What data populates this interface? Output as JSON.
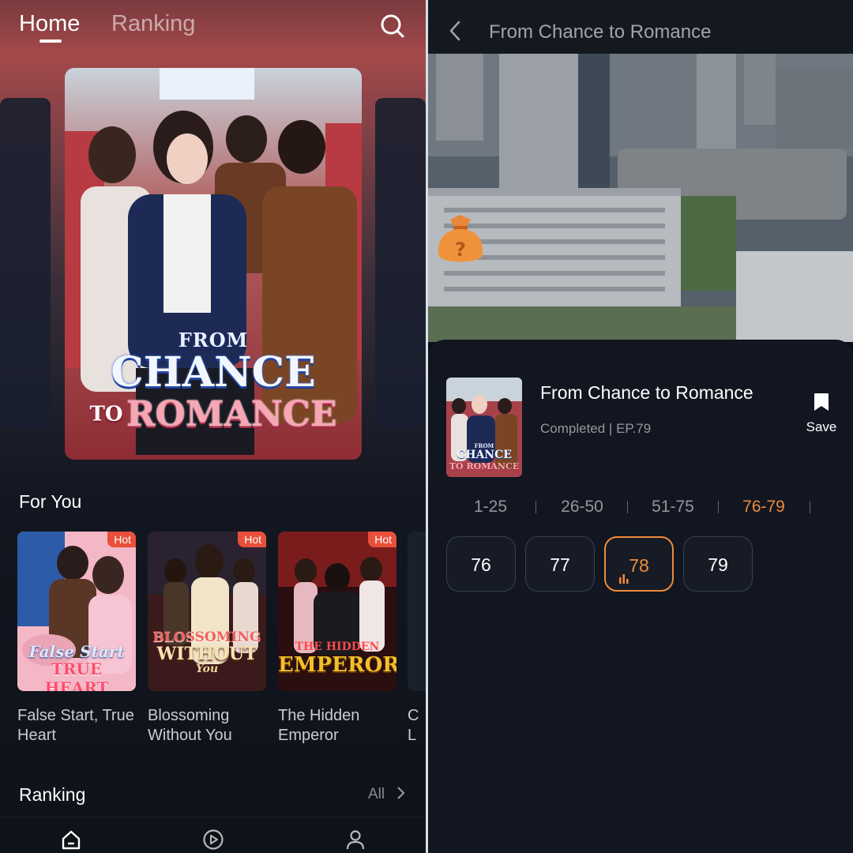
{
  "home": {
    "tabs": [
      {
        "label": "Home",
        "active": true
      },
      {
        "label": "Ranking",
        "active": false
      }
    ],
    "search_icon": "search-icon",
    "hero": {
      "poster_from": "FROM",
      "poster_chance": "CHANCE",
      "poster_to": "TO",
      "poster_romance": "ROMANCE"
    },
    "for_you": {
      "title": "For You",
      "cards": [
        {
          "badge": "Hot",
          "title": "False Start, True Heart",
          "poster_line1": "False Start",
          "poster_line2": "TRUE HEART"
        },
        {
          "badge": "Hot",
          "title": "Blossoming Without You",
          "poster_line1": "BLOSSOMING",
          "poster_line2": "WITHOUT",
          "poster_line3": "You"
        },
        {
          "badge": "Hot",
          "title": "The Hidden Emperor",
          "poster_line1": "THE HIDDEN",
          "poster_line2": "EMPEROR"
        }
      ],
      "partial_card_title": "C\nL"
    },
    "ranking": {
      "title": "Ranking",
      "all_label": "All"
    },
    "bottom_tabs": [
      {
        "icon": "home-icon",
        "active": true
      },
      {
        "icon": "play-circle-icon",
        "active": false
      },
      {
        "icon": "profile-icon",
        "active": false
      }
    ]
  },
  "player": {
    "header_title": "From Chance to Romance",
    "back_icon": "chevron-left-icon",
    "treasure_icon": "mystery-bag-icon",
    "series": {
      "title": "From Chance to Romance",
      "status": "Completed | EP.79",
      "thumb_from": "FROM",
      "thumb_chance": "CHANCE",
      "thumb_romance": "TO ROMANCE",
      "save_label": "Save",
      "save_icon": "bookmark-icon"
    },
    "ranges": [
      {
        "label": "1-25",
        "active": false
      },
      {
        "label": "26-50",
        "active": false
      },
      {
        "label": "51-75",
        "active": false
      },
      {
        "label": "76-79",
        "active": true
      }
    ],
    "episodes": [
      {
        "label": "76",
        "active": false
      },
      {
        "label": "77",
        "active": false
      },
      {
        "label": "78",
        "active": true
      },
      {
        "label": "79",
        "active": false
      }
    ],
    "accent_color": "#f08b3b"
  }
}
